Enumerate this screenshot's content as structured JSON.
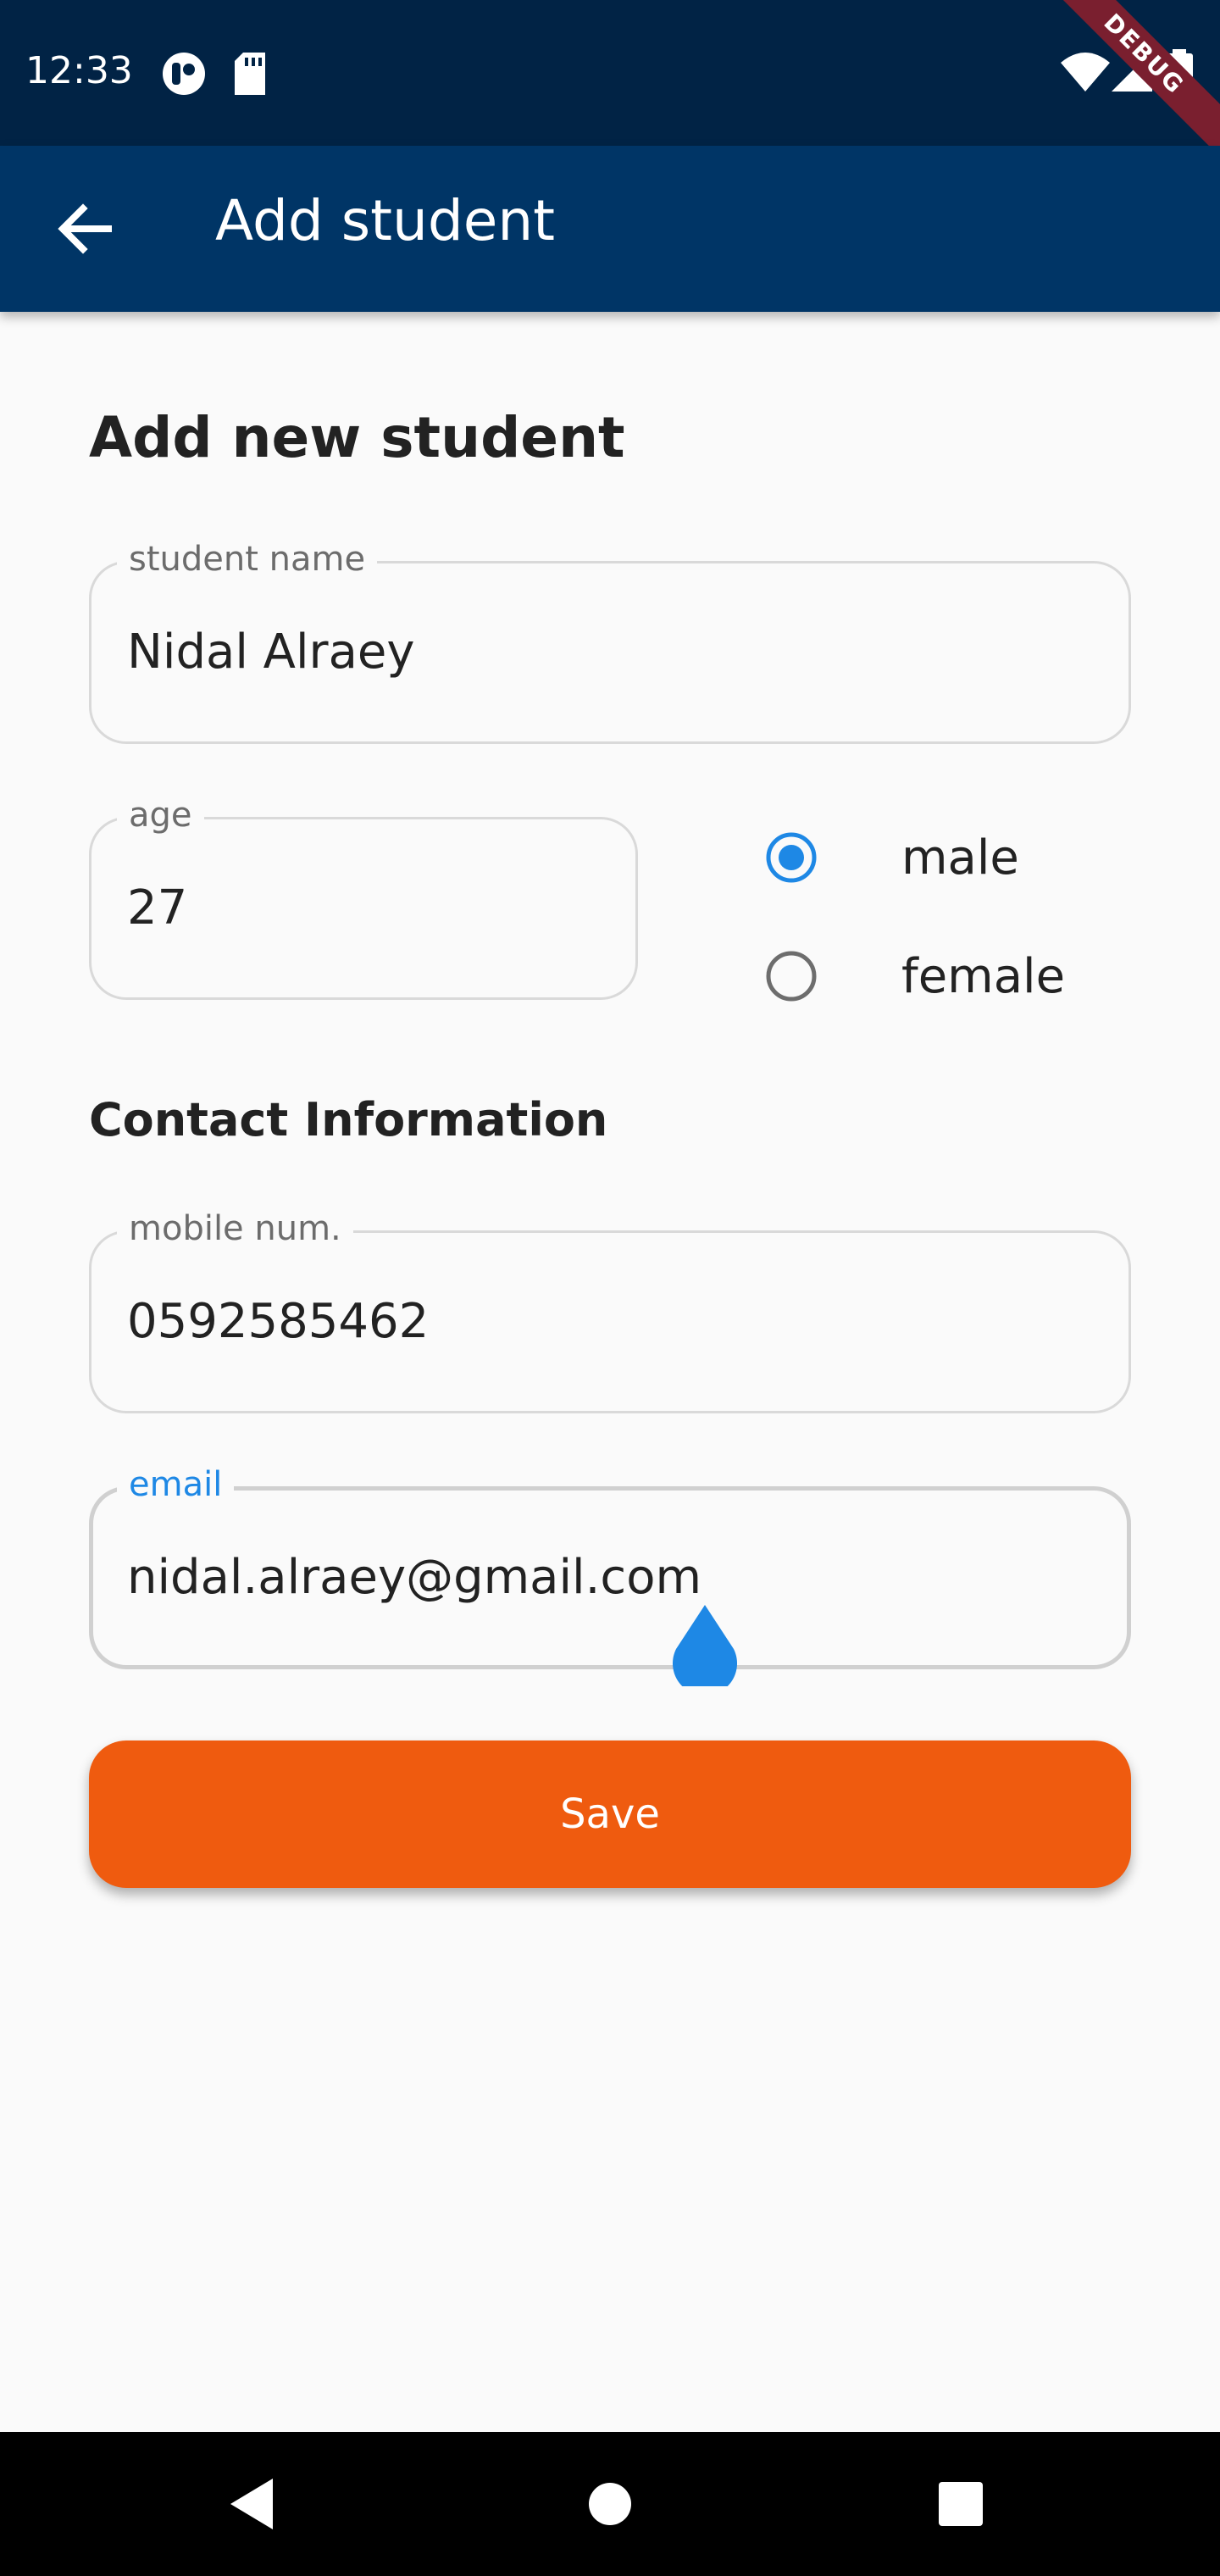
{
  "status_bar": {
    "time": "12:33",
    "debug_banner": "DEBUG",
    "icons": [
      "vpn-key-icon",
      "sd-card-icon",
      "wifi-icon",
      "signal-icon",
      "battery-icon"
    ]
  },
  "app_bar": {
    "title": "Add student",
    "back_icon": "arrow-back-icon",
    "background": "#003566"
  },
  "form": {
    "heading": "Add new student",
    "student_name": {
      "label": "student name",
      "value": "Nidal Alraey"
    },
    "age": {
      "label": "age",
      "value": "27"
    },
    "gender": {
      "options": [
        {
          "label": "male",
          "selected": true
        },
        {
          "label": "female",
          "selected": false
        }
      ]
    },
    "contact_heading": "Contact Information",
    "mobile": {
      "label": "mobile num.",
      "value": "0592585462"
    },
    "email": {
      "label": "email",
      "value": "nidal.alraey@gmail.com",
      "focused": true
    },
    "save_label": "Save"
  },
  "colors": {
    "accent": "#1e88e5",
    "save_button": "#ef5b0f",
    "status_bar": "#012345",
    "background": "#fafafa"
  },
  "nav_bar": {
    "buttons": [
      "back-triangle-icon",
      "home-circle-icon",
      "recents-square-icon"
    ]
  }
}
